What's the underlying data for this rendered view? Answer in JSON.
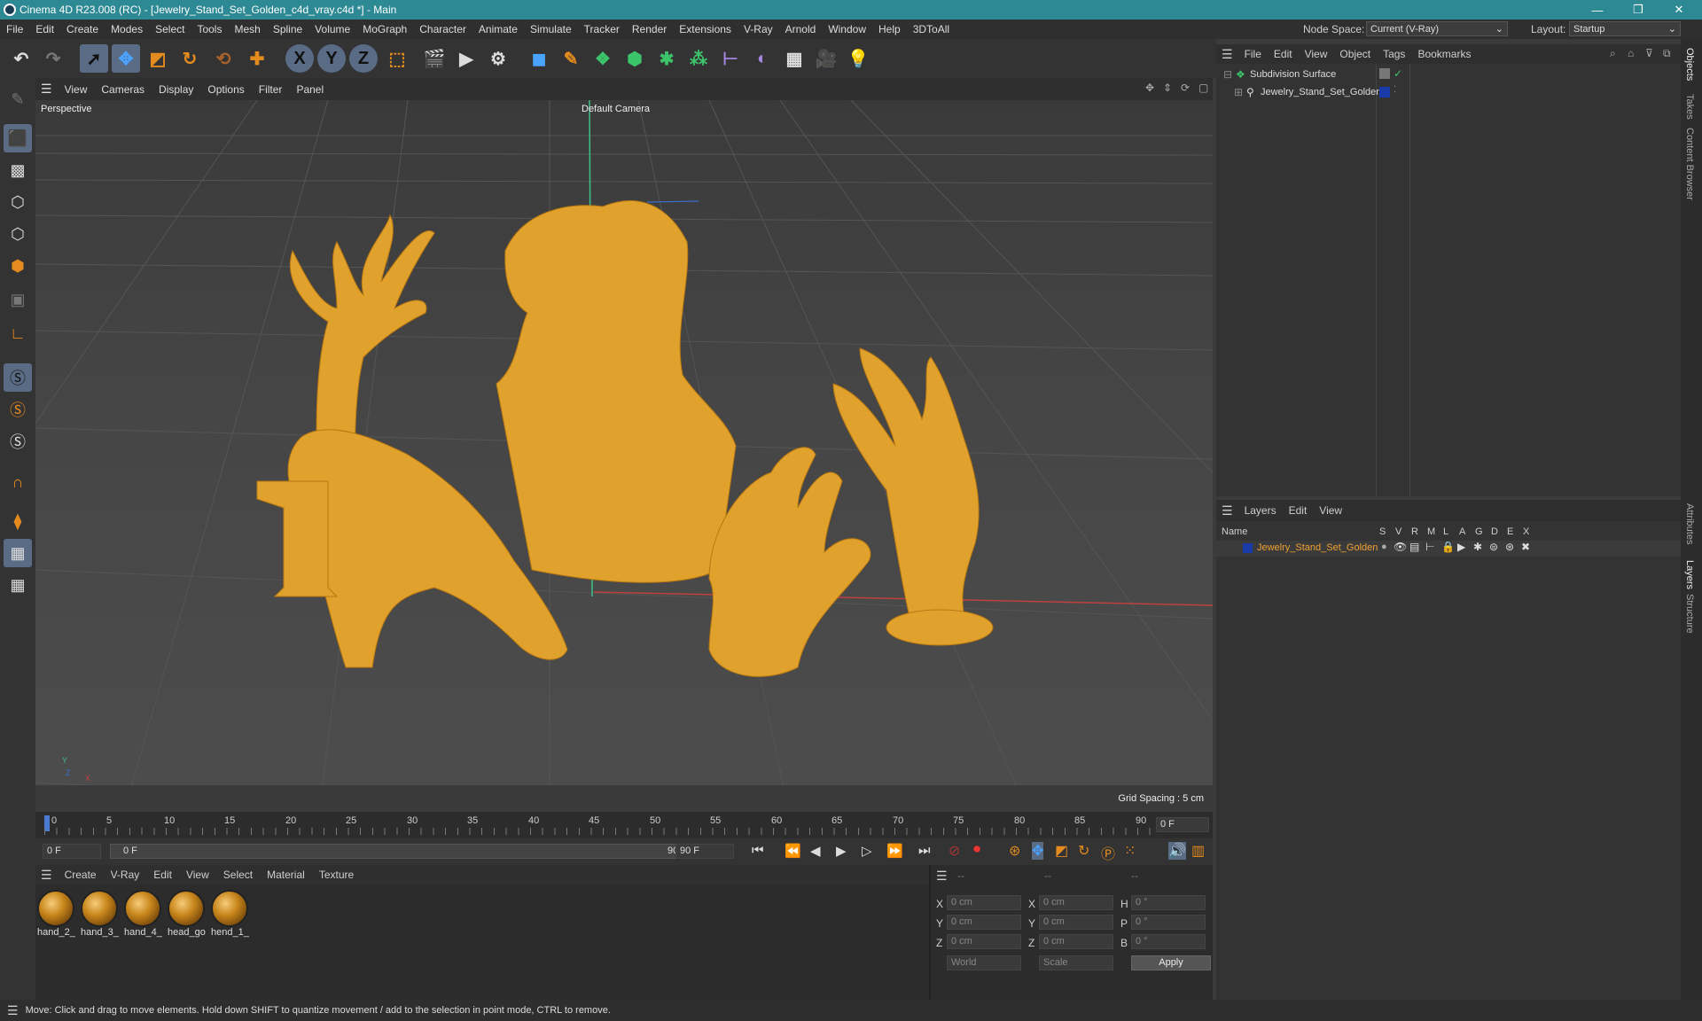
{
  "window": {
    "title": "Cinema 4D R23.008 (RC) - [Jewelry_Stand_Set_Golden_c4d_vray.c4d *] - Main",
    "controls": [
      "—",
      "❐",
      "✕"
    ]
  },
  "menubar": {
    "items": [
      "File",
      "Edit",
      "Create",
      "Modes",
      "Select",
      "Tools",
      "Mesh",
      "Spline",
      "Volume",
      "MoGraph",
      "Character",
      "Animate",
      "Simulate",
      "Tracker",
      "Render",
      "Extensions",
      "V-Ray",
      "Arnold",
      "Window",
      "Help",
      "3DToAll"
    ],
    "node_space_label": "Node Space:",
    "node_space_value": "Current (V-Ray)",
    "layout_label": "Layout:",
    "layout_value": "Startup"
  },
  "toolbar": {
    "x_label": "X",
    "y_label": "Y",
    "z_label": "Z"
  },
  "viewport": {
    "menu": [
      "View",
      "Cameras",
      "Display",
      "Options",
      "Filter",
      "Panel"
    ],
    "view_name": "Perspective",
    "camera": "Default Camera",
    "grid_spacing": "Grid Spacing : 5 cm",
    "axis_y": "Y",
    "axis_x": "X",
    "axis_z": "Z"
  },
  "timeline": {
    "ticks": [
      "0",
      "5",
      "10",
      "15",
      "20",
      "25",
      "30",
      "35",
      "40",
      "45",
      "50",
      "55",
      "60",
      "65",
      "70",
      "75",
      "80",
      "85",
      "90"
    ],
    "current_frame": "0 F"
  },
  "transport": {
    "start_field": "0 F",
    "range_start": "0 F",
    "range_end": "90 F",
    "end_field": "90 F"
  },
  "material_manager": {
    "menu": [
      "Create",
      "V-Ray",
      "Edit",
      "View",
      "Select",
      "Material",
      "Texture"
    ],
    "materials": [
      "hand_2_",
      "hand_3_",
      "hand_4_",
      "head_go",
      "hend_1_"
    ]
  },
  "coordinates": {
    "header": [
      "--",
      "--",
      "--"
    ],
    "rows": [
      {
        "a": "X",
        "av": "0 cm",
        "b": "X",
        "bv": "0 cm",
        "c": "H",
        "cv": "0 °"
      },
      {
        "a": "Y",
        "av": "0 cm",
        "b": "Y",
        "bv": "0 cm",
        "c": "P",
        "cv": "0 °"
      },
      {
        "a": "Z",
        "av": "0 cm",
        "b": "Z",
        "bv": "0 cm",
        "c": "B",
        "cv": "0 °"
      }
    ],
    "mode1": "World",
    "mode2": "Scale",
    "apply": "Apply"
  },
  "object_manager": {
    "menu": [
      "File",
      "Edit",
      "View",
      "Object",
      "Tags",
      "Bookmarks"
    ],
    "objects": [
      {
        "name": "Subdivision Surface"
      },
      {
        "name": "Jewelry_Stand_Set_Golden"
      }
    ]
  },
  "layer_manager": {
    "menu": [
      "Layers",
      "Edit",
      "View"
    ],
    "name_header": "Name",
    "columns": [
      "S",
      "V",
      "R",
      "M",
      "L",
      "A",
      "G",
      "D",
      "E",
      "X"
    ],
    "layers": [
      {
        "name": "Jewelry_Stand_Set_Golden",
        "color": "#1a3aa8"
      }
    ]
  },
  "side_tabs": [
    "Objects",
    "Takes",
    "Content Browser",
    "Attributes",
    "Layers",
    "Structure"
  ],
  "status": {
    "text": "Move: Click and drag to move elements. Hold down SHIFT to quantize movement / add to the selection in point mode, CTRL to remove."
  },
  "colors": {
    "titlebar": "#2d8a95",
    "gold": "#e0a22c",
    "layer_text": "#f0a030"
  }
}
